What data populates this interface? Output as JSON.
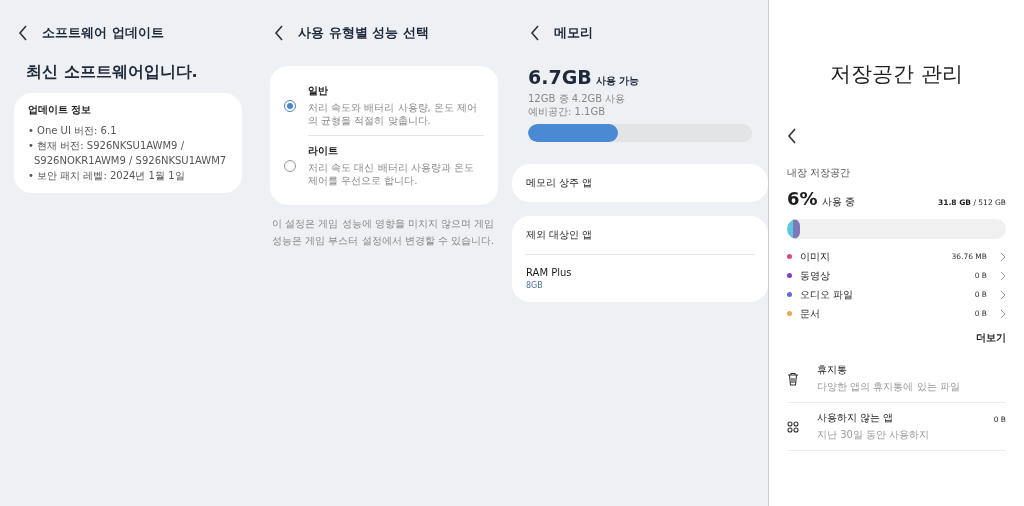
{
  "software_update": {
    "title": "소프트웨어 업데이트",
    "headline": "최신 소프트웨어입니다.",
    "info_title": "업데이트 정보",
    "info_lines": [
      "• One UI 버전: 6.1",
      "• 현재 버전: S926NKSU1AWM9 /",
      "S926NOKR1AWM9 / S926NKSU1AWM7",
      "• 보안 패치 레벨: 2024년 1월 1일"
    ]
  },
  "performance": {
    "title": "사용 유형별 성능 선택",
    "options": [
      {
        "label": "일반",
        "description": "처리 속도와 배터리 사용량, 온도 제어의 균형을 적절히 맞춥니다.",
        "selected": true
      },
      {
        "label": "라이트",
        "description": "처리 속도 대신 배터리 사용량과 온도 제어를 우선으로 합니다.",
        "selected": false
      }
    ],
    "note": "이 설정은 게임 성능에 영향을 미치지 않으며 게임 성능은 게임 부스터 설정에서 변경할 수 있습니다."
  },
  "memory": {
    "title": "메모리",
    "available": "6.7GB",
    "available_label": "사용 가능",
    "usage": "12GB 중 4.2GB 사용",
    "reserve": "예비공간: 1.1GB",
    "level": 0.4,
    "cards": [
      [
        {
          "label": "메모리 상주 앱"
        }
      ],
      [
        {
          "label": "제외 대상인 앱"
        },
        {
          "label": "RAM Plus",
          "value": "8GB"
        }
      ]
    ]
  },
  "storage": {
    "title": "저장공간 관리",
    "section": "내장 저장공간",
    "percent": "6%",
    "percent_label": "사용 중",
    "used": "31.8 GB",
    "total": "/ 512 GB",
    "level": 0.06,
    "categories": [
      {
        "label": "이미지",
        "size": "36.76 MB",
        "color": "#e0457b"
      },
      {
        "label": "동영상",
        "size": "0 B",
        "color": "#7b3fc9"
      },
      {
        "label": "오디오 파일",
        "size": "0 B",
        "color": "#5b6ee1"
      },
      {
        "label": "문서",
        "size": "0 B",
        "color": "#e8a94f"
      }
    ],
    "more": "더보기",
    "items": [
      {
        "kind": "trash",
        "title": "휴지통",
        "subtitle": "다양한 앱의 휴지통에 있는 파일"
      },
      {
        "kind": "apps",
        "title": "사용하지 않는 앱",
        "subtitle": "지난 30일 동안 사용하지",
        "size": "0 B"
      }
    ]
  }
}
